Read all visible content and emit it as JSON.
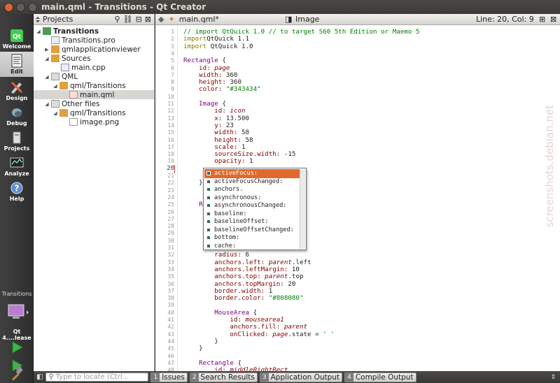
{
  "window": {
    "title": "main.qml - Transitions - Qt Creator"
  },
  "modes": [
    {
      "label": "Welcome"
    },
    {
      "label": "Edit"
    },
    {
      "label": "Design"
    },
    {
      "label": "Debug"
    },
    {
      "label": "Projects"
    },
    {
      "label": "Analyze"
    },
    {
      "label": "Help"
    }
  ],
  "target": {
    "project": "Transitions",
    "kit": "Qt 4....lease"
  },
  "projects_panel": {
    "title": "Projects",
    "tree": [
      {
        "label": "Transitions",
        "bold": true
      },
      {
        "label": "Transitions.pro"
      },
      {
        "label": "qmlapplicationviewer"
      },
      {
        "label": "Sources"
      },
      {
        "label": "main.cpp"
      },
      {
        "label": "QML"
      },
      {
        "label": "qml/Transitions"
      },
      {
        "label": "main.qml"
      },
      {
        "label": "Other files"
      },
      {
        "label": "qml/Transitions"
      },
      {
        "label": "image.png"
      }
    ]
  },
  "editor": {
    "file": "main.qml*",
    "symbol": "Image",
    "position": "Line: 20, Col: 9"
  },
  "code_lines": [
    {
      "n": "1",
      "parts": [
        [
          "c",
          "// import QtQuick 1.0 // to target S60 5th Edition or Maemo 5"
        ]
      ]
    },
    {
      "n": "2",
      "parts": [
        [
          "k",
          "import"
        ],
        [
          "",
          "QtQuick 1.1"
        ]
      ]
    },
    {
      "n": "3",
      "parts": [
        [
          "k",
          "import"
        ],
        [
          "",
          " QtQuick 1.0"
        ]
      ]
    },
    {
      "n": "4",
      "parts": []
    },
    {
      "n": "5",
      "parts": [
        [
          "t",
          "Rectangle"
        ],
        [
          "",
          " {"
        ]
      ]
    },
    {
      "n": "6",
      "parts": [
        [
          "p",
          "    id: "
        ],
        [
          "i",
          "page"
        ]
      ]
    },
    {
      "n": "7",
      "parts": [
        [
          "p",
          "    width: "
        ],
        [
          "",
          "360"
        ]
      ]
    },
    {
      "n": "8",
      "parts": [
        [
          "p",
          "    height: "
        ],
        [
          "",
          "360"
        ]
      ]
    },
    {
      "n": "9",
      "parts": [
        [
          "p",
          "    color: "
        ],
        [
          "s",
          "\"#343434\""
        ]
      ]
    },
    {
      "n": "10",
      "parts": []
    },
    {
      "n": "11",
      "parts": [
        [
          "t",
          "    Image"
        ],
        [
          "",
          " {"
        ]
      ]
    },
    {
      "n": "12",
      "parts": [
        [
          "p",
          "        id: "
        ],
        [
          "i",
          "icon"
        ]
      ]
    },
    {
      "n": "13",
      "parts": [
        [
          "p",
          "        x: "
        ],
        [
          "",
          "13.500"
        ]
      ]
    },
    {
      "n": "14",
      "parts": [
        [
          "p",
          "        y: "
        ],
        [
          "",
          "23"
        ]
      ]
    },
    {
      "n": "15",
      "parts": [
        [
          "p",
          "        width: "
        ],
        [
          "",
          "58"
        ]
      ]
    },
    {
      "n": "16",
      "parts": [
        [
          "p",
          "        height: "
        ],
        [
          "",
          "58"
        ]
      ]
    },
    {
      "n": "17",
      "parts": [
        [
          "p",
          "        scale: "
        ],
        [
          "",
          "1"
        ]
      ]
    },
    {
      "n": "18",
      "parts": [
        [
          "p",
          "        sourceSize.width: "
        ],
        [
          "",
          "-15"
        ]
      ]
    },
    {
      "n": "19",
      "parts": [
        [
          "p",
          "        opacity: "
        ],
        [
          "",
          "1"
        ]
      ]
    },
    {
      "n": "20",
      "parts": []
    },
    {
      "n": "21",
      "parts": []
    },
    {
      "n": "22",
      "parts": [
        [
          "",
          "    }"
        ]
      ]
    },
    {
      "n": "23",
      "parts": []
    },
    {
      "n": "24",
      "parts": []
    },
    {
      "n": "25",
      "parts": [
        [
          "t",
          "    Re"
        ]
      ]
    },
    {
      "n": "26",
      "parts": []
    },
    {
      "n": "27",
      "parts": []
    },
    {
      "n": "28",
      "parts": []
    },
    {
      "n": "29",
      "parts": []
    },
    {
      "n": "30",
      "parts": []
    },
    {
      "n": "31",
      "parts": []
    },
    {
      "n": "32",
      "parts": [
        [
          "p",
          "        radius: "
        ],
        [
          "",
          "6"
        ]
      ]
    },
    {
      "n": "33",
      "parts": [
        [
          "p",
          "        anchors.left: "
        ],
        [
          "i",
          "parent"
        ],
        [
          "",
          ".left"
        ]
      ]
    },
    {
      "n": "34",
      "parts": [
        [
          "p",
          "        anchors.leftMargin: "
        ],
        [
          "",
          "10"
        ]
      ]
    },
    {
      "n": "35",
      "parts": [
        [
          "p",
          "        anchors.top: "
        ],
        [
          "i",
          "parent"
        ],
        [
          "",
          ".top"
        ]
      ]
    },
    {
      "n": "36",
      "parts": [
        [
          "p",
          "        anchors.topMargin: "
        ],
        [
          "",
          "20"
        ]
      ]
    },
    {
      "n": "37",
      "parts": [
        [
          "p",
          "        border.width: "
        ],
        [
          "",
          "1"
        ]
      ]
    },
    {
      "n": "38",
      "parts": [
        [
          "p",
          "        border.color: "
        ],
        [
          "s",
          "\"#808080\""
        ]
      ]
    },
    {
      "n": "39",
      "parts": []
    },
    {
      "n": "40",
      "parts": [
        [
          "t",
          "        MouseArea"
        ],
        [
          "",
          " {"
        ]
      ]
    },
    {
      "n": "41",
      "parts": [
        [
          "p",
          "            id: "
        ],
        [
          "i",
          "mousearea1"
        ]
      ]
    },
    {
      "n": "42",
      "parts": [
        [
          "p",
          "            anchors.fill: "
        ],
        [
          "i",
          "parent"
        ]
      ]
    },
    {
      "n": "43",
      "parts": [
        [
          "p",
          "            onClicked: "
        ],
        [
          "i",
          "page"
        ],
        [
          "",
          ".state = "
        ],
        [
          "s",
          "' '"
        ]
      ]
    },
    {
      "n": "44",
      "parts": [
        [
          "",
          "        }"
        ]
      ]
    },
    {
      "n": "45",
      "parts": [
        [
          "",
          "    }"
        ]
      ]
    },
    {
      "n": "46",
      "parts": []
    },
    {
      "n": "47",
      "parts": [
        [
          "t",
          "    Rectangle"
        ],
        [
          "",
          " {"
        ]
      ]
    },
    {
      "n": "48",
      "parts": [
        [
          "p",
          "        id: "
        ],
        [
          "i",
          "middleRightRect"
        ]
      ]
    }
  ],
  "completion": {
    "items": [
      "activeFocus:",
      "activeFocusChanged:",
      "anchors.",
      "asynchronous:",
      "asynchronousChanged:",
      "baseline:",
      "baselineOffset:",
      "baselineOffsetChanged:",
      "bottom:",
      "cache:"
    ],
    "selected": 0
  },
  "output_bar": {
    "locator_placeholder": "Type to locate (Ctrl...",
    "tabs": [
      {
        "num": "1",
        "label": "Issues"
      },
      {
        "num": "2",
        "label": "Search Results"
      },
      {
        "num": "3",
        "label": "Application Output"
      },
      {
        "num": "4",
        "label": "Compile Output"
      }
    ]
  },
  "watermark": "screenshots.debian.net",
  "colors": {
    "accent": "#e06a2e",
    "modebar": "#3a3a3a"
  }
}
